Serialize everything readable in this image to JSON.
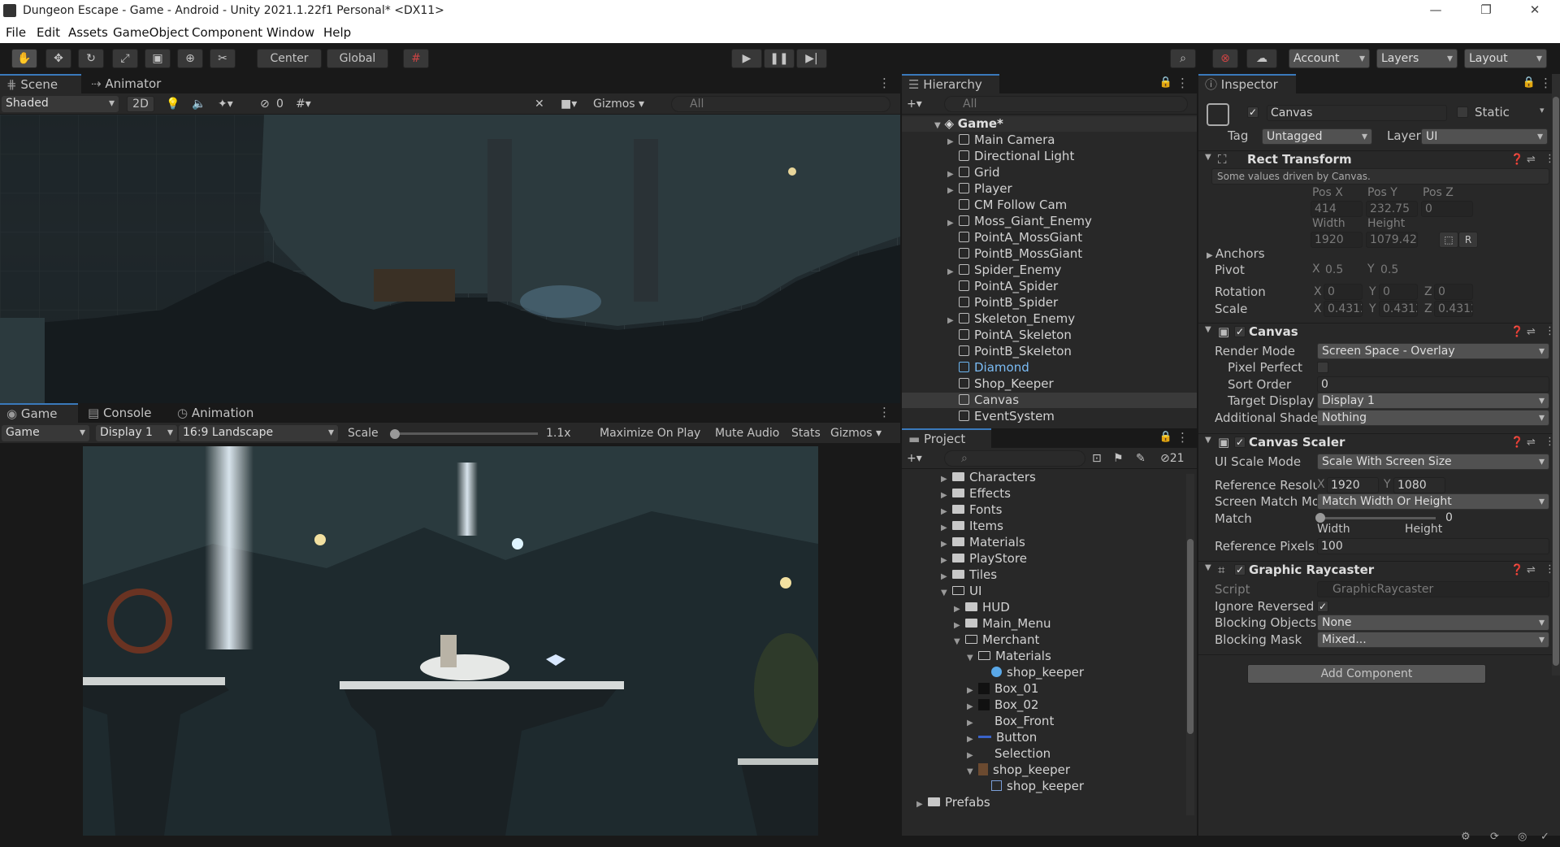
{
  "window": {
    "title": "Dungeon Escape - Game - Android - Unity 2021.1.22f1 Personal* <DX11>",
    "minimize": "—",
    "restore": "❐",
    "close": "✕"
  },
  "menu": [
    "File",
    "Edit",
    "Assets",
    "GameObject",
    "Component",
    "Window",
    "Help"
  ],
  "toolbar": {
    "center": "Center",
    "global": "Global",
    "account": "Account",
    "layers": "Layers",
    "layout": "Layout"
  },
  "scene": {
    "tabs": [
      "Scene",
      "Animator"
    ],
    "shading": "Shaded",
    "mode2d": "2D",
    "hidden_count": "0",
    "gizmos": "Gizmos",
    "search_placeholder": "All"
  },
  "game": {
    "tabs": [
      "Game",
      "Console",
      "Animation"
    ],
    "view": "Game",
    "display": "Display 1",
    "aspect": "16:9 Landscape",
    "scale_label": "Scale",
    "scale_value": "1.1x",
    "scale_level": 0.02,
    "maximize": "Maximize On Play",
    "mute": "Mute Audio",
    "stats": "Stats",
    "gizmos": "Gizmos"
  },
  "hierarchy": {
    "title": "Hierarchy",
    "search_placeholder": "All",
    "scene": "Game*",
    "items": [
      {
        "name": "Main Camera",
        "expand": true
      },
      {
        "name": "Directional Light",
        "expand": false
      },
      {
        "name": "Grid",
        "expand": true
      },
      {
        "name": "Player",
        "expand": true
      },
      {
        "name": "CM Follow Cam",
        "expand": false
      },
      {
        "name": "Moss_Giant_Enemy",
        "expand": true
      },
      {
        "name": "PointA_MossGiant",
        "expand": false
      },
      {
        "name": "PointB_MossGiant",
        "expand": false
      },
      {
        "name": "Spider_Enemy",
        "expand": true
      },
      {
        "name": "PointA_Spider",
        "expand": false
      },
      {
        "name": "PointB_Spider",
        "expand": false
      },
      {
        "name": "Skeleton_Enemy",
        "expand": true
      },
      {
        "name": "PointA_Skeleton",
        "expand": false
      },
      {
        "name": "PointB_Skeleton",
        "expand": false
      },
      {
        "name": "Diamond",
        "expand": false,
        "prefab": true
      },
      {
        "name": "Shop_Keeper",
        "expand": false
      },
      {
        "name": "Canvas",
        "expand": false,
        "selected": true
      },
      {
        "name": "EventSystem",
        "expand": false
      }
    ]
  },
  "project": {
    "title": "Project",
    "hidden_count": "21",
    "items": [
      {
        "name": "Characters",
        "depth": 0,
        "open": false
      },
      {
        "name": "Effects",
        "depth": 0,
        "open": false
      },
      {
        "name": "Fonts",
        "depth": 0,
        "open": false
      },
      {
        "name": "Items",
        "depth": 0,
        "open": false
      },
      {
        "name": "Materials",
        "depth": 0,
        "open": false
      },
      {
        "name": "PlayStore",
        "depth": 0,
        "open": false
      },
      {
        "name": "Tiles",
        "depth": 0,
        "open": false
      },
      {
        "name": "UI",
        "depth": 0,
        "open": true
      },
      {
        "name": "HUD",
        "depth": 1,
        "open": false
      },
      {
        "name": "Main_Menu",
        "depth": 1,
        "open": false
      },
      {
        "name": "Merchant",
        "depth": 1,
        "open": true
      },
      {
        "name": "Materials",
        "depth": 2,
        "open": true
      },
      {
        "name": "shop_keeper",
        "depth": 3,
        "kind": "material"
      },
      {
        "name": "Box_01",
        "depth": 2,
        "kind": "sprite-dark"
      },
      {
        "name": "Box_02",
        "depth": 2,
        "kind": "sprite-dark"
      },
      {
        "name": "Box_Front",
        "depth": 2,
        "kind": "sprite"
      },
      {
        "name": "Button",
        "depth": 2,
        "kind": "sprite-blue"
      },
      {
        "name": "Selection",
        "depth": 2,
        "kind": "sprite"
      },
      {
        "name": "shop_keeper",
        "depth": 2,
        "kind": "sprite-char",
        "open": true
      },
      {
        "name": "shop_keeper",
        "depth": 3,
        "kind": "sprite-sub"
      },
      {
        "name": "Prefabs",
        "depth": -1,
        "kind": "folder-cut"
      }
    ]
  },
  "inspector": {
    "title": "Inspector",
    "object_name": "Canvas",
    "static": "Static",
    "tag_label": "Tag",
    "tag": "Untagged",
    "layer_label": "Layer",
    "layer": "UI",
    "rect": {
      "title": "Rect Transform",
      "note": "Some values driven by Canvas.",
      "posx_label": "Pos X",
      "posy_label": "Pos Y",
      "posz_label": "Pos Z",
      "posx": "414",
      "posy": "232.75",
      "posz": "0",
      "width_label": "Width",
      "height_label": "Height",
      "width": "1920",
      "height": "1079.42",
      "anchors": "Anchors",
      "pivot": "Pivot",
      "pivot_x": "0.5",
      "pivot_y": "0.5",
      "rotation": "Rotation",
      "rot_x": "0",
      "rot_y": "0",
      "rot_z": "0",
      "scale": "Scale",
      "scale_x": "0.43125",
      "scale_y": "0.43125",
      "scale_z": "0.43125",
      "x": "X",
      "y": "Y",
      "z": "Z",
      "r": "R"
    },
    "canvas": {
      "title": "Canvas",
      "render_mode_label": "Render Mode",
      "render_mode": "Screen Space - Overlay",
      "pixel_perfect": "Pixel Perfect",
      "sort_order_label": "Sort Order",
      "sort_order": "0",
      "target_display_label": "Target Display",
      "target_display": "Display 1",
      "shader_label": "Additional Shader Ch",
      "shader": "Nothing"
    },
    "scaler": {
      "title": "Canvas Scaler",
      "mode_label": "UI Scale Mode",
      "mode": "Scale With Screen Size",
      "res_label": "Reference Resolutio",
      "res_x": "1920",
      "res_y": "1080",
      "match_mode_label": "Screen Match Mode",
      "match_mode": "Match Width Or Height",
      "match_label": "Match",
      "match": "0",
      "match_level": 0,
      "width": "Width",
      "height": "Height",
      "ppu_label": "Reference Pixels Per",
      "ppu": "100"
    },
    "raycaster": {
      "title": "Graphic Raycaster",
      "script_label": "Script",
      "script": "GraphicRaycaster",
      "ignore_label": "Ignore Reversed Gra",
      "blocking_label": "Blocking Objects",
      "blocking": "None",
      "mask_label": "Blocking Mask",
      "mask": "Mixed..."
    },
    "add_component": "Add Component"
  }
}
